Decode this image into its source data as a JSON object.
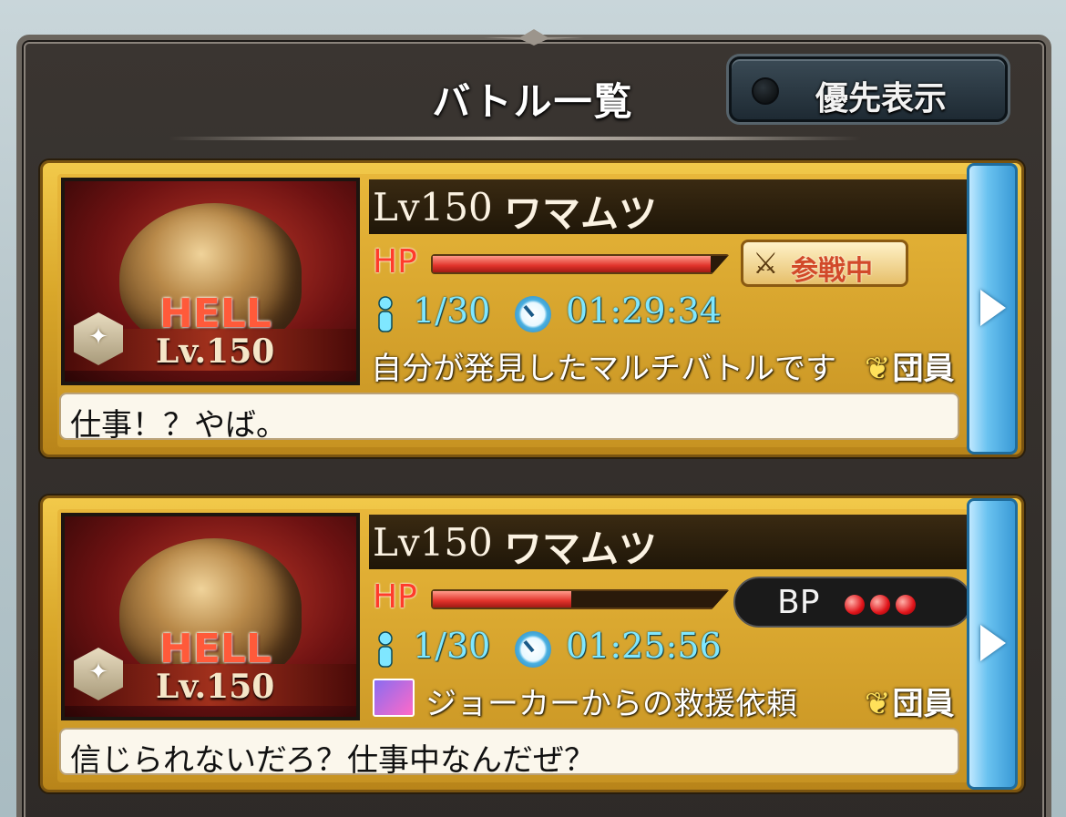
{
  "panel": {
    "title": "バトル一覧",
    "priority_label": "優先表示"
  },
  "cards": [
    {
      "thumb": {
        "difficulty": "HELL",
        "level": "Lv.150"
      },
      "level": "Lv150",
      "name": "ワマムツ",
      "hp_label": "HP",
      "hp_fraction": 0.94,
      "status_badge": "参戦中",
      "players": "1/30",
      "time": "01:29:34",
      "description": "自分が発見したマルチバトルです",
      "member_tag": "団員",
      "comment": "仕事！？やば。"
    },
    {
      "thumb": {
        "difficulty": "HELL",
        "level": "Lv.150"
      },
      "level": "Lv150",
      "name": "ワマムツ",
      "hp_label": "HP",
      "hp_fraction": 0.47,
      "bp_label": "BP",
      "bp_count": 3,
      "players": "1/30",
      "time": "01:25:56",
      "description": "ジョーカーからの救援依頼",
      "member_tag": "団員",
      "comment": "信じられないだろ？仕事中なんだぜ？"
    }
  ],
  "colors": {
    "hp_red": "#e0322a",
    "stat_cyan": "#7fe7ff",
    "card_gold": "#d9a72a",
    "arrow_blue": "#3a9ad6"
  },
  "icons": [
    "person-icon",
    "clock-icon",
    "crossed-swords-icon",
    "star-rank-icon",
    "guild-crest-icon",
    "arrow-right-icon"
  ]
}
